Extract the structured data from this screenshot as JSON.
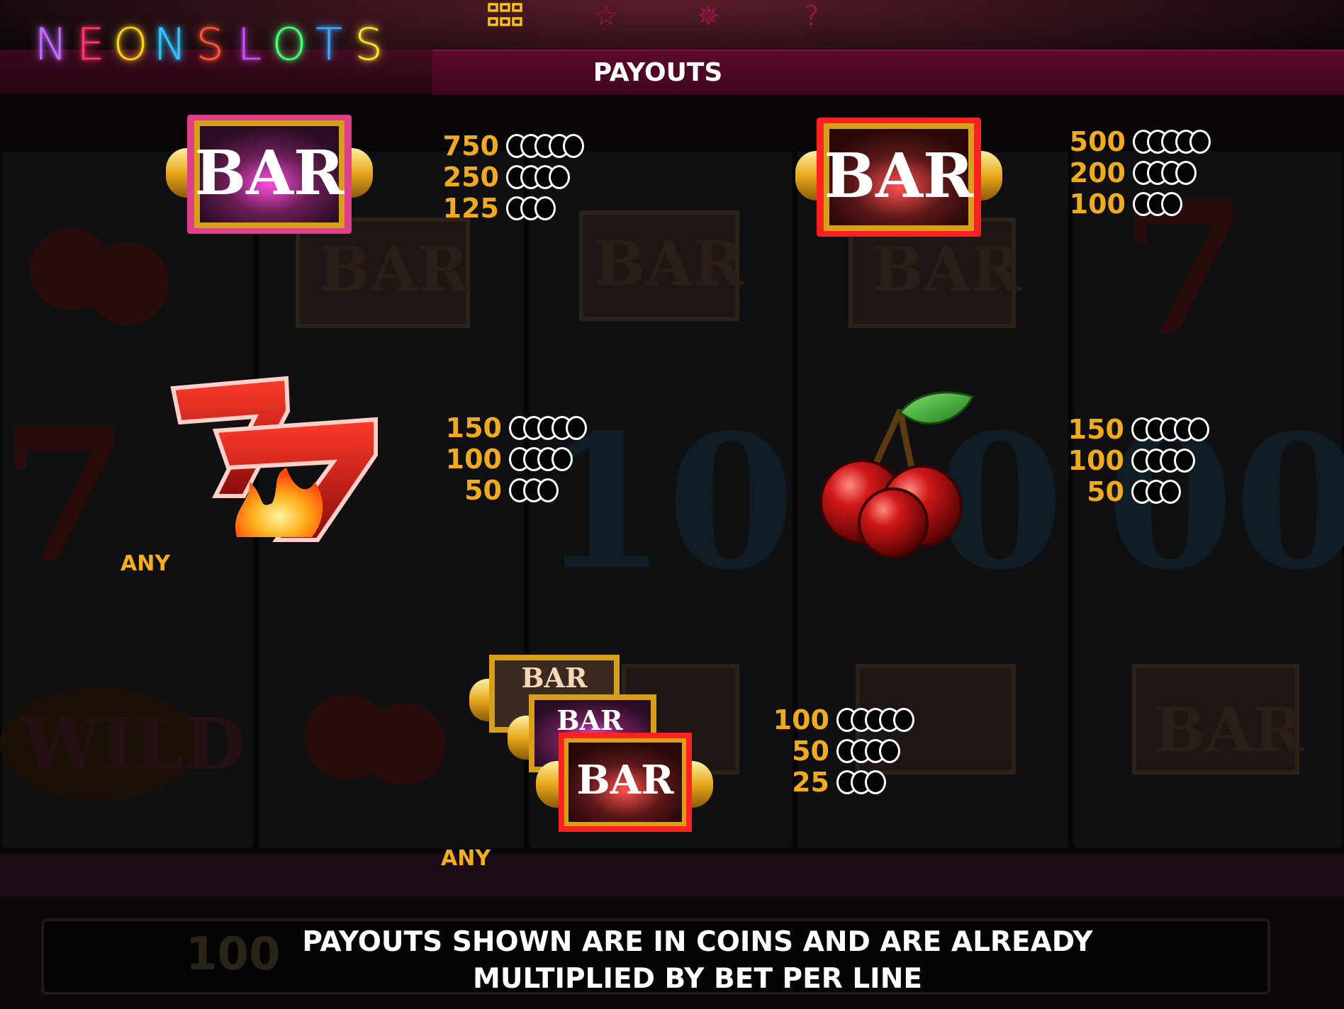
{
  "header": {
    "logo_letters": [
      {
        "ch": "N",
        "color": "#c46cff"
      },
      {
        "ch": "E",
        "color": "#ff3b6e"
      },
      {
        "ch": "O",
        "color": "#ffd21f"
      },
      {
        "ch": "N",
        "color": "#34c6ff"
      },
      {
        "ch": "S",
        "color": "#ff5a3a"
      },
      {
        "ch": "L",
        "color": "#d34cff"
      },
      {
        "ch": "O",
        "color": "#4cff7a"
      },
      {
        "ch": "T",
        "color": "#3fa8ff"
      },
      {
        "ch": "S",
        "color": "#ffe23a"
      }
    ],
    "menu_icons": [
      "grid-icon",
      "star-icon",
      "sparkle-icon",
      "help-icon"
    ],
    "title": "PAYOUTS"
  },
  "paytable": {
    "purple_bar": [
      {
        "value": "750",
        "coins": 5
      },
      {
        "value": "250",
        "coins": 4
      },
      {
        "value": "125",
        "coins": 3
      }
    ],
    "red_bar": [
      {
        "value": "500",
        "coins": 5
      },
      {
        "value": "200",
        "coins": 4
      },
      {
        "value": "100",
        "coins": 3
      }
    ],
    "sevens": [
      {
        "value": "150",
        "coins": 5
      },
      {
        "value": "100",
        "coins": 4
      },
      {
        "value": "50",
        "coins": 3
      }
    ],
    "cherries": [
      {
        "value": "150",
        "coins": 5
      },
      {
        "value": "100",
        "coins": 4
      },
      {
        "value": "50",
        "coins": 3
      }
    ],
    "any_bar": [
      {
        "value": "100",
        "coins": 5
      },
      {
        "value": "50",
        "coins": 4
      },
      {
        "value": "25",
        "coins": 3
      }
    ],
    "any_label": "ANY",
    "bar_text": "BAR"
  },
  "footer": {
    "line1": "PAYOUTS SHOWN ARE IN COINS AND ARE ALREADY",
    "line2": "MULTIPLIED BY BET PER LINE",
    "bg_number": "100"
  },
  "colors": {
    "accent": "#f2ae1c",
    "title_bar": "#5d0a2c",
    "background": "#050405"
  }
}
